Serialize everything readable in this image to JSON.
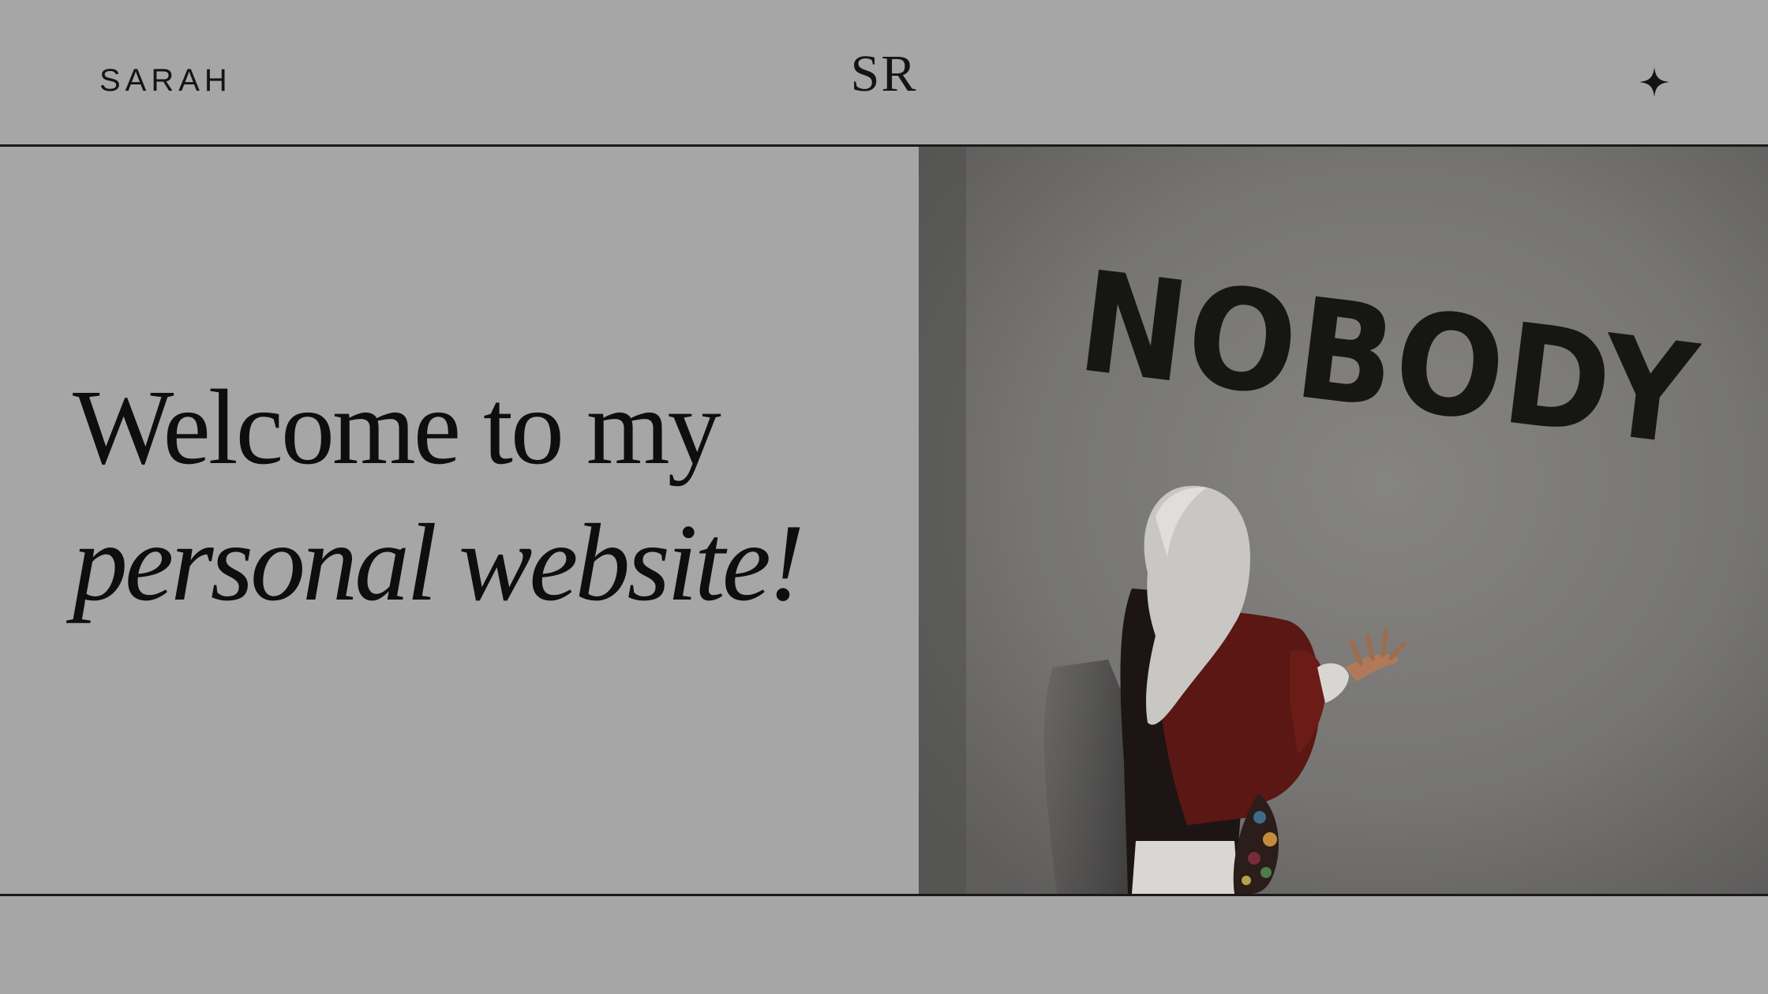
{
  "header": {
    "name": "SARAH",
    "monogram": "SR",
    "sparkle_icon": "sparkle-icon"
  },
  "hero": {
    "headline_line1": "Welcome to my",
    "headline_line2": "personal website!",
    "photo": {
      "wall_text": "NOBODY",
      "description_icon": "photo-person-by-wall"
    }
  },
  "colors": {
    "background": "#a6a6a6",
    "text": "#141414",
    "rule": "#1a1a1a"
  }
}
